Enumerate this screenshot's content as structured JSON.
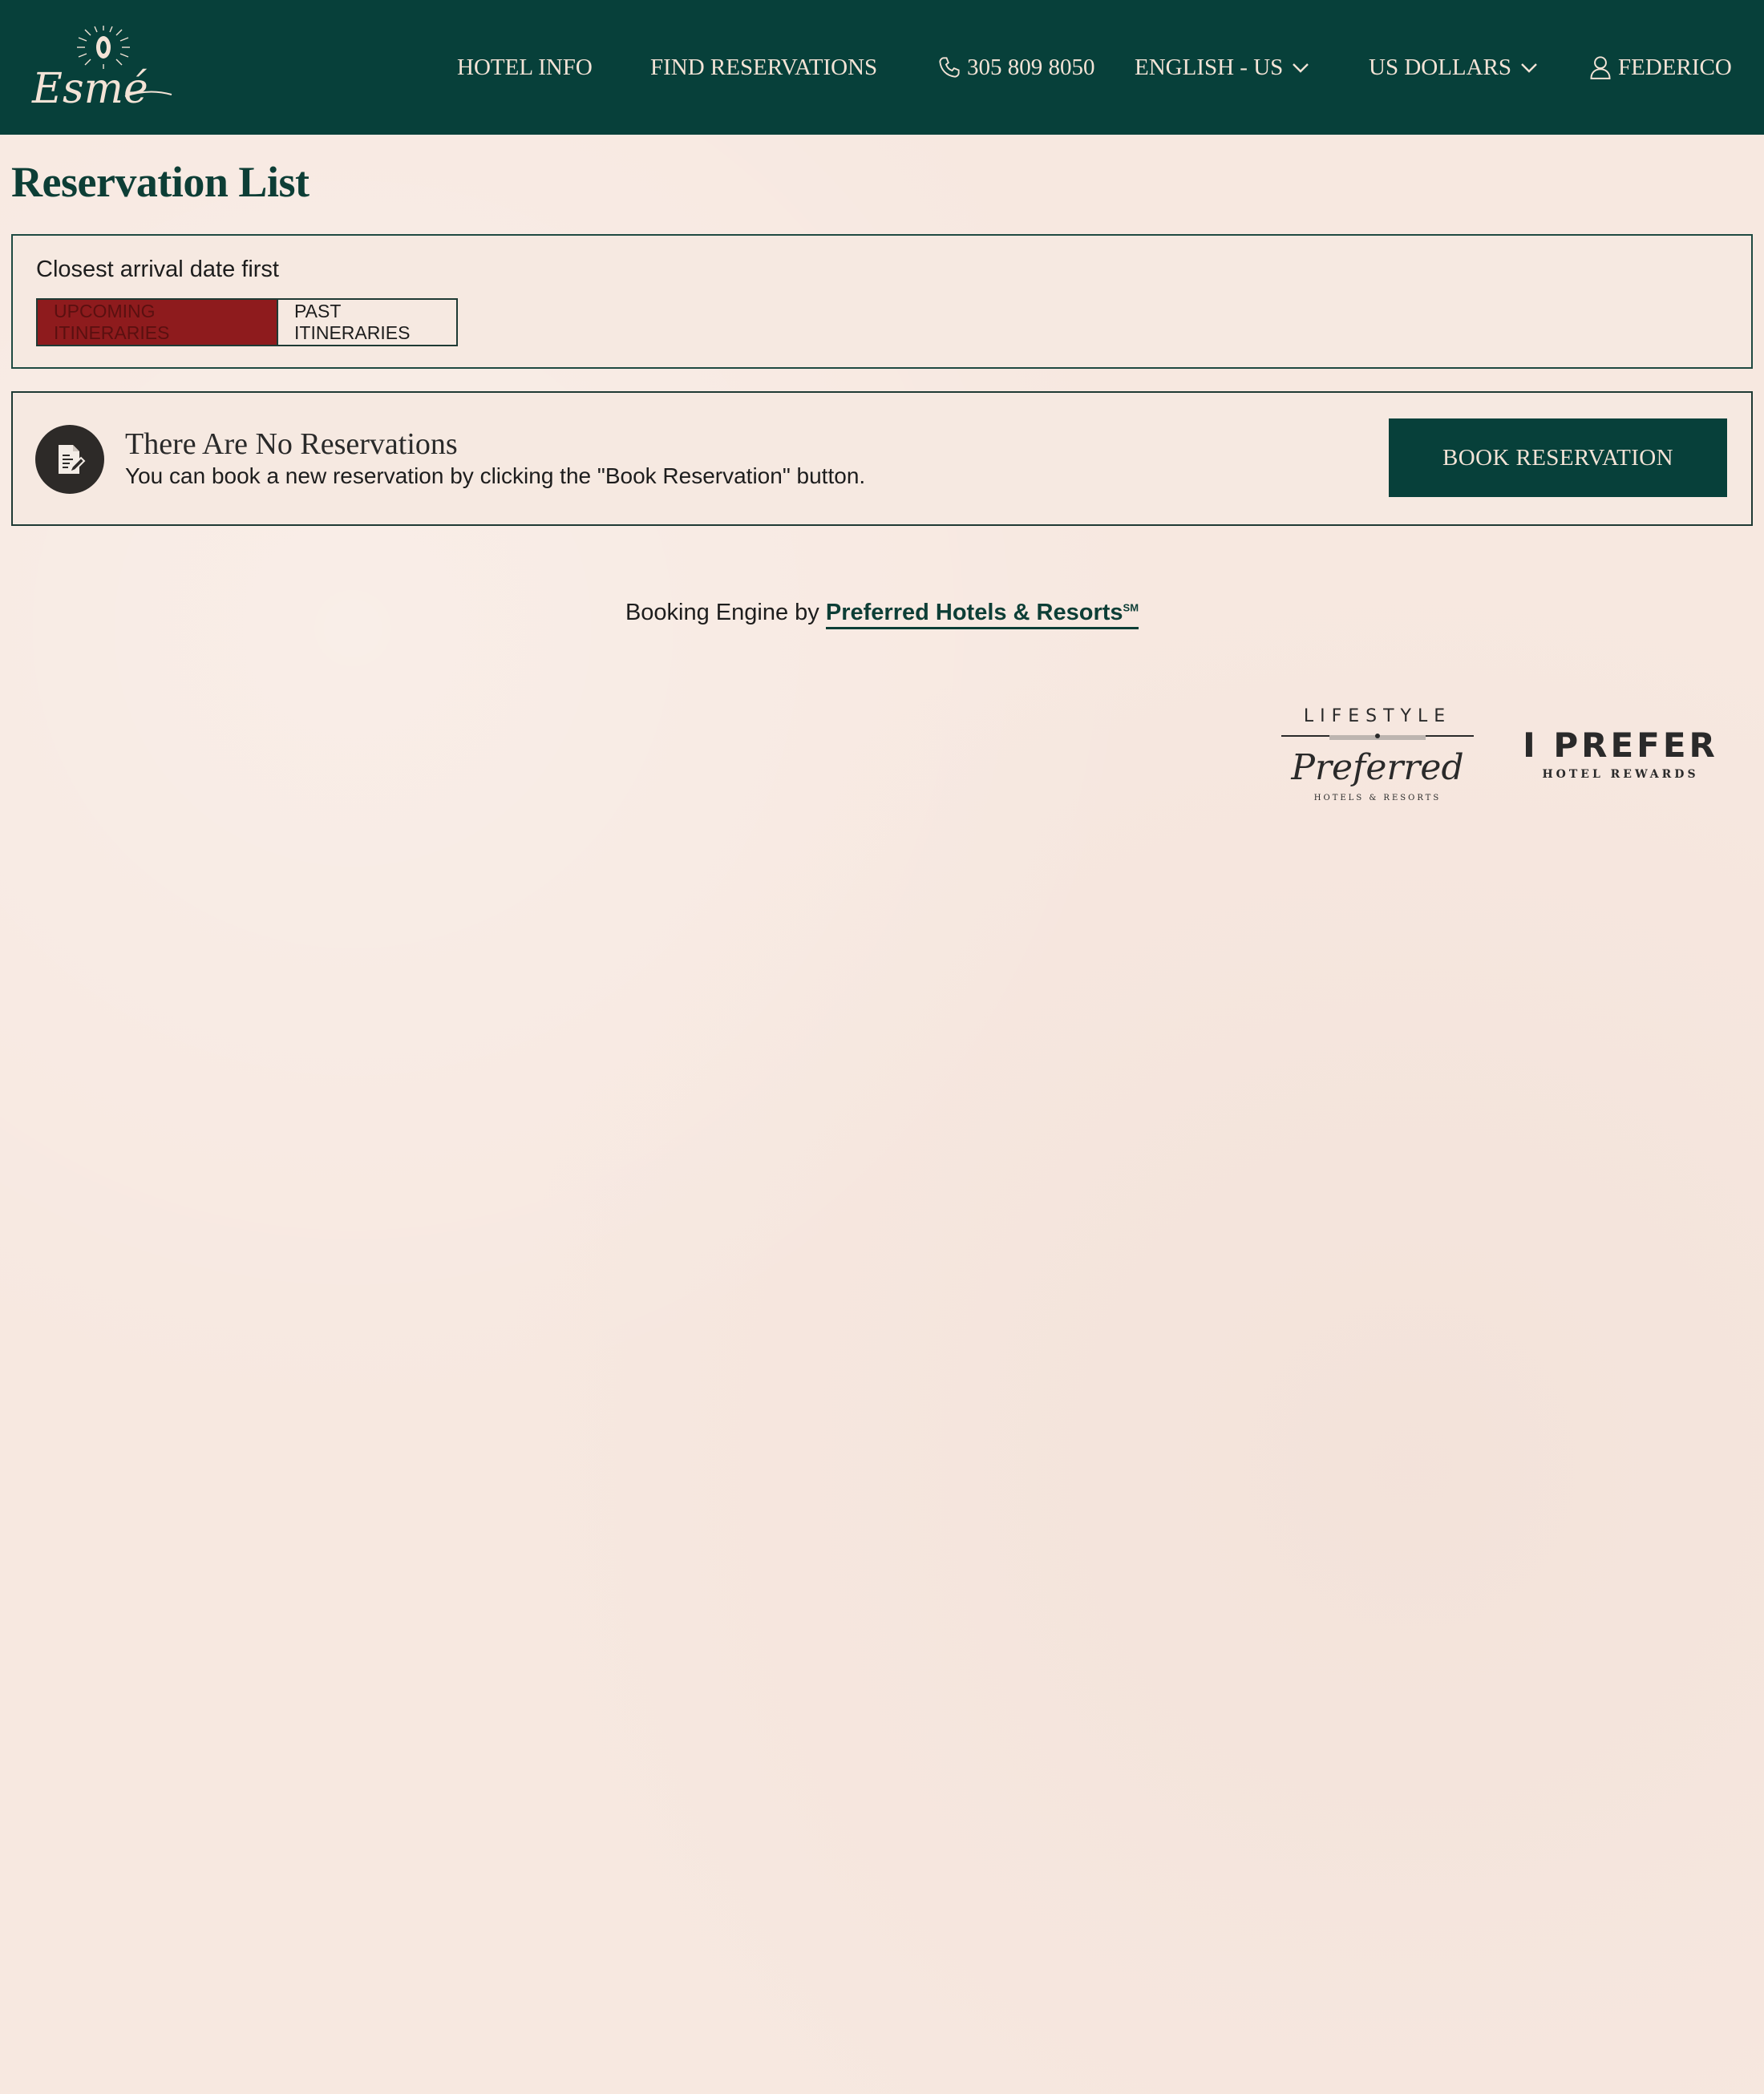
{
  "brand": {
    "logo_text": "Esmé",
    "primary_color": "#07403a",
    "background_color": "#f7e8e0",
    "accent_color": "#8e1b1d"
  },
  "nav": {
    "hotel_info": "HOTEL INFO",
    "find_reservations": "FIND RESERVATIONS",
    "phone": "305 809 8050",
    "phone_icon": "phone-icon",
    "language": "ENGLISH - US",
    "currency": "US DOLLARS",
    "user": "FEDERICO",
    "user_icon": "user-icon"
  },
  "page": {
    "title": "Reservation List"
  },
  "sort": {
    "label": "Closest arrival date first",
    "tabs": [
      {
        "label": "UPCOMING ITINERARIES",
        "active": true
      },
      {
        "label": "PAST ITINERARIES",
        "active": false
      }
    ]
  },
  "empty_state": {
    "icon": "document-edit-icon",
    "title": "There Are No Reservations",
    "description": "You can book a new reservation by clicking the \"Book Reservation\" button.",
    "button_label": "BOOK RESERVATION"
  },
  "footer": {
    "powered_prefix": "Booking Engine by",
    "powered_link": "Preferred Hotels & Resorts",
    "powered_mark": "SM",
    "partner_logos": [
      {
        "name": "lifestyle-preferred-logo",
        "top_text": "LIFESTYLE",
        "script_text": "Preferred",
        "bottom_text": "HOTELS & RESORTS"
      },
      {
        "name": "i-prefer-logo",
        "top_text": "I PREFER",
        "bottom_text": "HOTEL REWARDS"
      }
    ]
  }
}
